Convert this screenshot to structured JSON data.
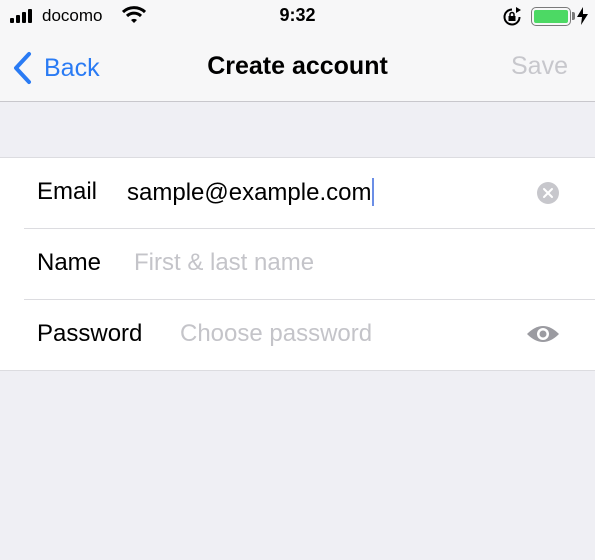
{
  "status_bar": {
    "carrier": "docomo",
    "time": "9:32",
    "battery_level": 1.0,
    "icons": [
      "signal-bars-icon",
      "wifi-icon",
      "orientation-lock-icon",
      "battery-icon",
      "charging-bolt-icon"
    ]
  },
  "nav": {
    "back_label": "Back",
    "title": "Create account",
    "save_label": "Save"
  },
  "form": {
    "email": {
      "label": "Email",
      "value": "sample@example.com"
    },
    "name": {
      "label": "Name",
      "placeholder": "First & last name"
    },
    "password": {
      "label": "Password",
      "placeholder": "Choose password"
    }
  },
  "colors": {
    "accent": "#2a7bf4",
    "disabled": "#c7c7cc",
    "battery": "#4cd964",
    "background": "#efeff4"
  }
}
